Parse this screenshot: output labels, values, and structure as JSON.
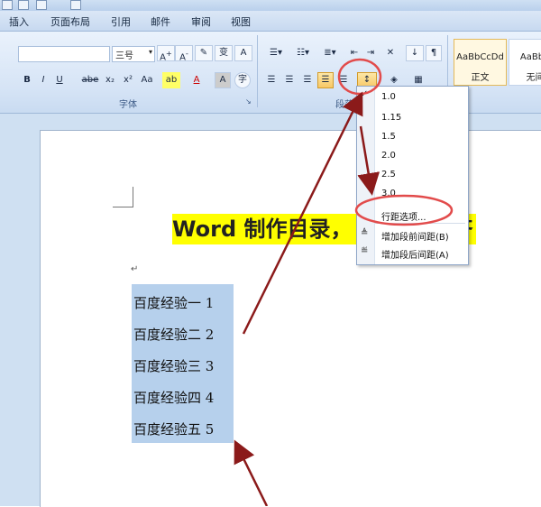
{
  "ribbon_tabs": [
    "插入",
    "页面布局",
    "引用",
    "邮件",
    "审阅",
    "视图"
  ],
  "font_group": {
    "font_size": "三号",
    "label": "字体",
    "buttons": [
      "B",
      "I",
      "U",
      "abe",
      "x₂",
      "x²",
      "Aa"
    ]
  },
  "paragraph_group": {
    "label": "段落"
  },
  "styles": [
    {
      "preview": "AaBbCcDd",
      "name": "正文"
    },
    {
      "preview": "AaBbC",
      "name": "无间"
    }
  ],
  "document": {
    "title": "Word 制作目录，",
    "title_tail": "对齐",
    "toc_lines": [
      "百度经验一 1",
      "百度经验二 2",
      "百度经验三 3",
      "百度经验四 4",
      "百度经验五 5"
    ]
  },
  "line_spacing_menu": {
    "options": [
      "1.0",
      "1.15",
      "1.5",
      "2.0",
      "2.5",
      "3.0"
    ],
    "line_spacing_options_label": "行距选项...",
    "add_space_before": "增加段前间距(B)",
    "add_space_after": "增加段后间距(A)"
  },
  "colors": {
    "highlight": "#ffff00",
    "selection": "#b6d0ec",
    "annotation": "#8b1a1a",
    "circle": "#e24b4b"
  }
}
